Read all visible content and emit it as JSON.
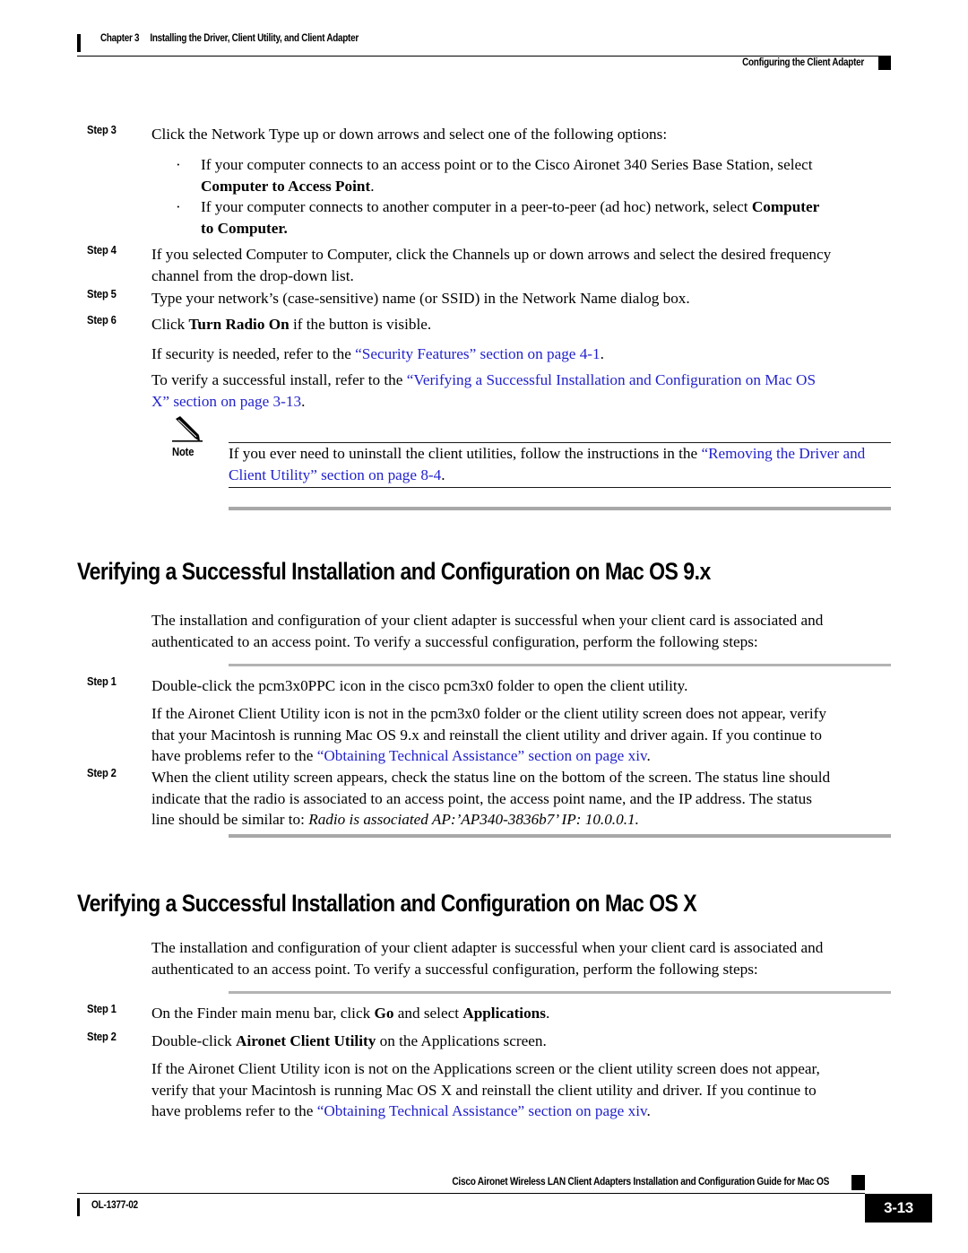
{
  "header": {
    "chapter_label": "Chapter 3",
    "chapter_title": "Installing the Driver, Client Utility, and Client Adapter",
    "section_title": "Configuring the Client Adapter"
  },
  "steps": {
    "step3": {
      "label": "Step 3",
      "text": "Click the Network Type up or down arrows and select one of the following options:",
      "bullets": [
        {
          "marker": "·",
          "text_before": "If your computer connects to an access point or to the Cisco Aironet 340 Series Base Station, select ",
          "bold": "Computer to Access Point",
          "text_after": "."
        },
        {
          "marker": "·",
          "text_before": "If your computer connects to another computer in a peer-to-peer (ad hoc) network, select ",
          "bold": "Computer to Computer.",
          "text_after": ""
        }
      ]
    },
    "step4": {
      "label": "Step 4",
      "text": "If you selected Computer to Computer, click the Channels up or down arrows and select the desired frequency channel from the drop-down list."
    },
    "step5": {
      "label": "Step 5",
      "text": "Type your network’s (case-sensitive) name (or SSID) in the Network Name dialog box."
    },
    "step6": {
      "label": "Step 6",
      "text_before": "Click ",
      "bold": "Turn Radio On",
      "text_after": " if the button is visible."
    }
  },
  "security_note": {
    "text_before": "If security is needed, refer to the ",
    "xref": "“Security Features” section on page 4-1",
    "text_after": "."
  },
  "verify_note": {
    "text_before": "To verify a successful install, refer to the ",
    "xref": "“Verifying a Successful Installation and Configuration on Mac OS X” section on page 3-13",
    "text_after": "."
  },
  "note_block": {
    "icon": "pencil-icon",
    "label": "Note",
    "text_before": "If you ever need to uninstall the client utilities, follow the instructions in the ",
    "xref": "“Removing the Driver and Client Utility” section on page 8-4",
    "text_after": "."
  },
  "section_os9": {
    "heading": "Verifying a Successful Installation and Configuration on Mac OS 9.x",
    "intro": "The installation and configuration of your client adapter is successful when your client card is associated and authenticated to an access point. To verify a successful configuration, perform the following steps:",
    "step1": {
      "label": "Step 1",
      "text": "Double-click the pcm3x0PPC icon in the cisco pcm3x0 folder to open the client utility."
    },
    "step1_followup": {
      "text_before": "If the Aironet Client Utility icon is not in the pcm3x0 folder or the client utility screen does not appear, verify that your Macintosh is running Mac OS 9.x and reinstall the client utility and driver again. If you continue to have problems refer to the ",
      "xref": "“Obtaining Technical Assistance” section on page xiv",
      "text_after": "."
    },
    "step2": {
      "label": "Step 2",
      "text_before": "When the client utility screen appears, check the status line on the bottom of the screen. The status line should indicate that the radio is associated to an access point, the access point name, and the IP address. The status line should be similar to: ",
      "italic": "Radio is associated AP:’AP340-3836b7’ IP: 10.0.0.1.",
      "text_after": ""
    }
  },
  "section_osx": {
    "heading": "Verifying a Successful Installation and Configuration on Mac OS X",
    "intro": "The installation and configuration of your client adapter is successful when your client card is associated and authenticated to an access point. To verify a successful configuration, perform the following steps:",
    "step1": {
      "label": "Step 1",
      "text_before": "On the Finder main menu bar, click ",
      "bold1": "Go",
      "text_mid": " and select ",
      "bold2": "Applications",
      "text_after": "."
    },
    "step2": {
      "label": "Step 2",
      "text_before": "Double-click ",
      "bold": "Aironet Client Utility",
      "text_after": " on the Applications screen."
    },
    "step2_followup": {
      "text_before": "If the Aironet Client Utility icon is not on the Applications screen or the client utility screen does not appear, verify that your Macintosh is running Mac OS X and reinstall the client utility and driver. If you continue to have problems refer to the ",
      "xref": "“Obtaining Technical Assistance” section on page xiv",
      "text_after": "."
    }
  },
  "footer": {
    "guide_title": "Cisco Aironet Wireless LAN Client Adapters Installation and Configuration Guide for Mac OS",
    "doc_number": "OL-1377-02",
    "page_number": "3-13"
  },
  "colors": {
    "xref_blue": "#2222CC",
    "rule_gray": "#a8a8a8",
    "ink": "#000000"
  }
}
